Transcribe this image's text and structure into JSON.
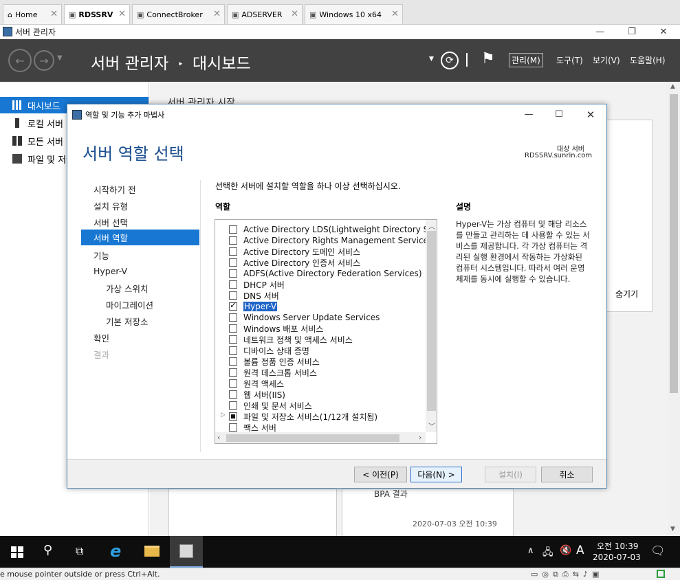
{
  "vm_tabs": [
    {
      "label": "Home",
      "icon": "home-icon"
    },
    {
      "label": "RDSSRV",
      "icon": "vm-icon",
      "active": true
    },
    {
      "label": "ConnectBroker",
      "icon": "vm-icon"
    },
    {
      "label": "ADSERVER",
      "icon": "vm-icon"
    },
    {
      "label": "Windows 10 x64",
      "icon": "vm-icon"
    }
  ],
  "server_manager": {
    "window_title": "서버 관리자",
    "breadcrumb_app": "서버 관리자",
    "breadcrumb_sep": "‣",
    "breadcrumb_page": "대시보드",
    "menus": [
      "관리(M)",
      "도구(T)",
      "보기(V)",
      "도움말(H)"
    ],
    "sidebar": [
      "대시보드",
      "로컬 서버",
      "모든 서버",
      "파일 및 저장소 서비스"
    ],
    "main_heading": "서버 관리자 시작",
    "hide_link": "숨기기",
    "bpa_label": "BPA 결과",
    "bpa_timestamp": "2020-07-03 오전 10:39"
  },
  "wizard": {
    "title": "역할 및 기능 추가 마법사",
    "heading": "서버 역할 선택",
    "target_label": "대상 서버",
    "target_server": "RDSSRV.sunrin.com",
    "steps": [
      {
        "label": "시작하기 전",
        "level": 0,
        "state": "normal"
      },
      {
        "label": "설치 유형",
        "level": 0,
        "state": "normal"
      },
      {
        "label": "서버 선택",
        "level": 0,
        "state": "normal"
      },
      {
        "label": "서버 역할",
        "level": 0,
        "state": "selected"
      },
      {
        "label": "기능",
        "level": 0,
        "state": "normal"
      },
      {
        "label": "Hyper-V",
        "level": 0,
        "state": "normal"
      },
      {
        "label": "가상 스위치",
        "level": 1,
        "state": "normal"
      },
      {
        "label": "마이그레이션",
        "level": 1,
        "state": "normal"
      },
      {
        "label": "기본 저장소",
        "level": 1,
        "state": "normal"
      },
      {
        "label": "확인",
        "level": 0,
        "state": "normal"
      },
      {
        "label": "결과",
        "level": 0,
        "state": "disabled"
      }
    ],
    "instruction": "선택한 서버에 설치할 역할을 하나 이상 선택하십시오.",
    "roles_header": "역할",
    "roles": [
      {
        "label": "Active Directory LDS(Lightweight Directory Services)",
        "checked": false
      },
      {
        "label": "Active Directory Rights Management Services",
        "checked": false
      },
      {
        "label": "Active Directory 도메인 서비스",
        "checked": false
      },
      {
        "label": "Active Directory 인증서 서비스",
        "checked": false
      },
      {
        "label": "ADFS(Active Directory Federation Services)",
        "checked": false
      },
      {
        "label": "DHCP 서버",
        "checked": false
      },
      {
        "label": "DNS 서버",
        "checked": false
      },
      {
        "label": "Hyper-V",
        "checked": true,
        "highlighted": true
      },
      {
        "label": "Windows Server Update Services",
        "checked": false
      },
      {
        "label": "Windows 배포 서비스",
        "checked": false
      },
      {
        "label": "네트워크 정책 및 액세스 서비스",
        "checked": false
      },
      {
        "label": "디바이스 상태 증명",
        "checked": false
      },
      {
        "label": "볼륨 정품 인증 서비스",
        "checked": false
      },
      {
        "label": "원격 데스크톱 서비스",
        "checked": false
      },
      {
        "label": "원격 액세스",
        "checked": false
      },
      {
        "label": "웹 서버(IIS)",
        "checked": false
      },
      {
        "label": "인쇄 및 문서 서비스",
        "checked": false
      },
      {
        "label": "파일 및 저장소 서비스(1/12개 설치됨)",
        "checked": "partial",
        "expandable": true
      },
      {
        "label": "팩스 서버",
        "checked": false
      }
    ],
    "description_header": "설명",
    "description": "Hyper-V는 가상 컴퓨터 및 해당 리소스를 만들고 관리하는 데 사용할 수 있는 서비스를 제공합니다. 각 가상 컴퓨터는 격리된 실행 환경에서 작동하는 가상화된 컴퓨터 시스템입니다. 따라서 여러 운영 체제를 동시에 실행할 수 있습니다.",
    "buttons": {
      "prev": "< 이전(P)",
      "next": "다음(N) >",
      "install": "설치(I)",
      "cancel": "취소"
    }
  },
  "taskbar": {
    "time": "오전 10:39",
    "date": "2020-07-03",
    "ime": "A"
  },
  "vm_status": "e mouse pointer outside or press Ctrl+Alt."
}
